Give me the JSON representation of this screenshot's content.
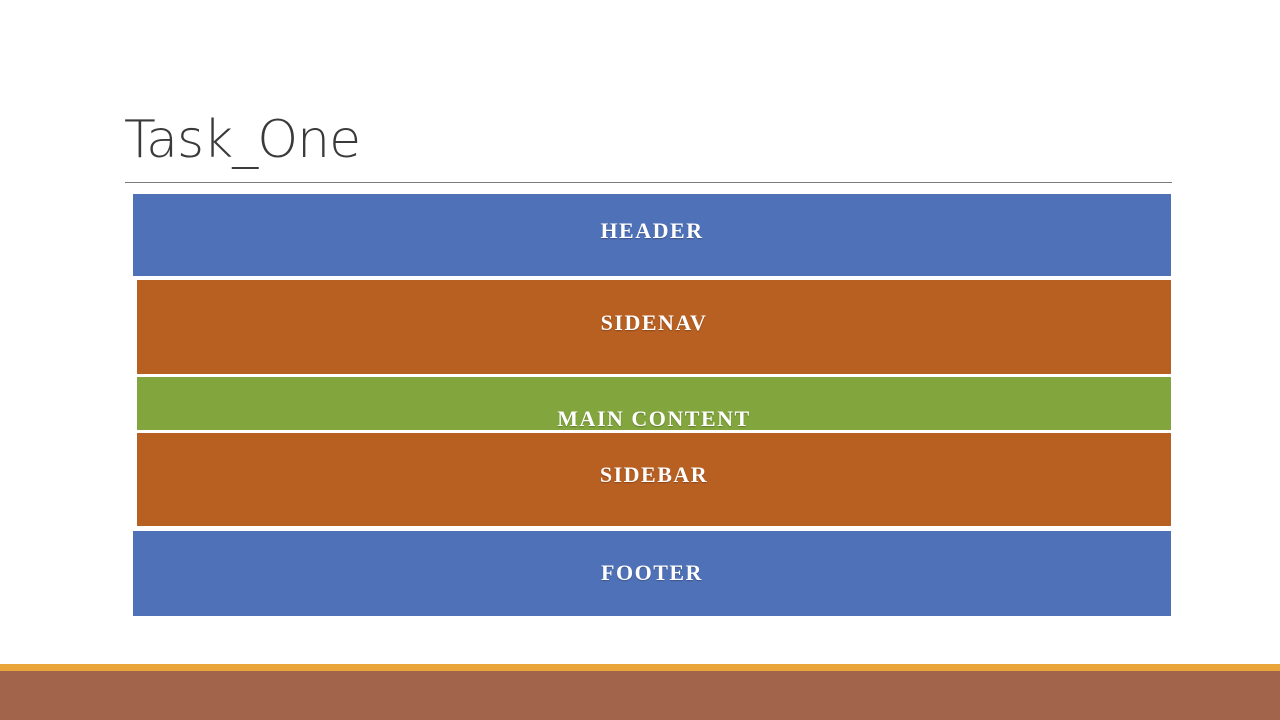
{
  "title": "Task_One",
  "colors": {
    "header": "#4f71b7",
    "sidenav": "#b85f22",
    "main_content": "#82a53d",
    "sidebar": "#b85f22",
    "footer": "#4f71b7",
    "bottom_accent": "#e9a43a",
    "bottom_band": "#a2644b"
  },
  "layout_blocks": [
    {
      "id": "header",
      "label": "HEADER"
    },
    {
      "id": "sidenav",
      "label": "SIDENAV"
    },
    {
      "id": "main_content",
      "label": "MAIN CONTENT"
    },
    {
      "id": "sidebar",
      "label": "SIDEBAR"
    },
    {
      "id": "footer",
      "label": "FOOTER"
    }
  ]
}
